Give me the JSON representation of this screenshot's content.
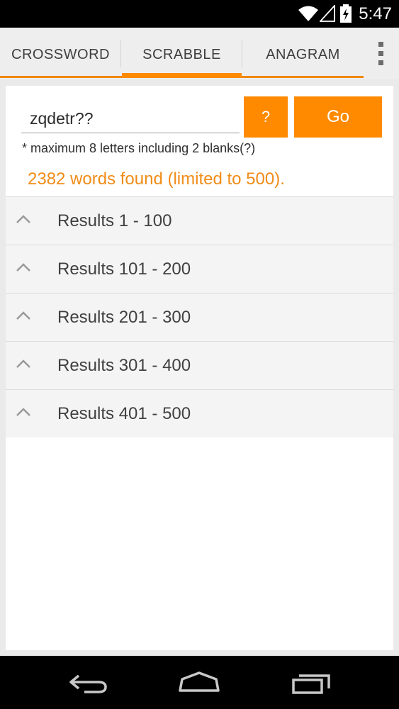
{
  "status": {
    "time": "5:47"
  },
  "tabs": [
    {
      "label": "CROSSWORD"
    },
    {
      "label": "SCRABBLE"
    },
    {
      "label": "ANAGRAM"
    }
  ],
  "search": {
    "value": "zqdetr??"
  },
  "buttons": {
    "help_label": "?",
    "go_label": "Go"
  },
  "hint": "* maximum 8 letters including 2 blanks(?)",
  "found_text": "2382 words found (limited to 500).",
  "results": [
    {
      "label": "Results 1 - 100"
    },
    {
      "label": "Results 101 - 200"
    },
    {
      "label": "Results 201 - 300"
    },
    {
      "label": "Results 301 - 400"
    },
    {
      "label": "Results 401 - 500"
    }
  ],
  "colors": {
    "accent": "#ff8a00",
    "found_text": "#f08c18"
  },
  "icons": {
    "status": [
      "wifi-icon",
      "signal-icon",
      "battery-icon"
    ],
    "nav": [
      "back-icon",
      "home-icon",
      "recents-icon"
    ],
    "overflow": "overflow-menu-icon",
    "row": "chevron-up-icon"
  }
}
